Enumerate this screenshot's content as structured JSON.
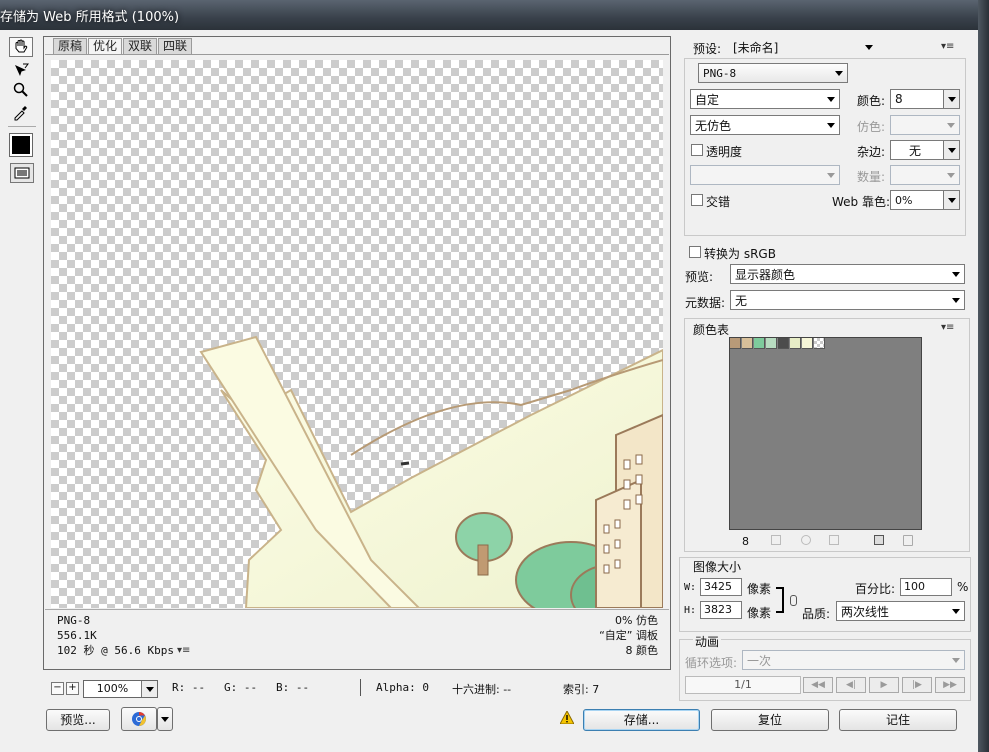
{
  "window": {
    "title": "存储为 Web 所用格式 (100%)"
  },
  "tools": [
    "hand-tool",
    "slice-select-tool",
    "zoom-tool",
    "eyedropper-tool"
  ],
  "tabs": [
    "原稿",
    "优化",
    "双联",
    "四联"
  ],
  "active_tab": "优化",
  "canvas_info": {
    "format": "PNG-8",
    "size": "556.1K",
    "speed": "102 秒 @ 56.6 Kbps",
    "dither": "0% 仿色",
    "palette": "“自定” 调板",
    "colors": "8 颜色"
  },
  "statusbar": {
    "zoom": "100%",
    "r": "R: --",
    "g": "G: --",
    "b": "B: --",
    "alpha": "Alpha: 0",
    "hex": "十六进制: --",
    "index": "索引: 7"
  },
  "buttons": {
    "preview": "预览...",
    "save": "存储...",
    "reset": "复位",
    "remember": "记住"
  },
  "settings": {
    "preset_label": "预设:",
    "preset_value": "[未命名]",
    "format": "PNG-8",
    "reduction": "自定",
    "colors_label": "颜色:",
    "colors_value": "8",
    "dither_algo": "无仿色",
    "dither_label": "仿色:",
    "transparency_label": "透明度",
    "matte_label": "杂边:",
    "matte_value": "无",
    "amount_label": "数量:",
    "interlaced_label": "交错",
    "websnap_label": "Web 靠色:",
    "websnap_value": "0%"
  },
  "color_mgmt": {
    "convert_label": "转换为 sRGB",
    "preview_label": "预览:",
    "preview_value": "显示器颜色",
    "metadata_label": "元数据:",
    "metadata_value": "无"
  },
  "color_table": {
    "title": "颜色表",
    "count": "8",
    "swatches": [
      "#b89a78",
      "#d8c09a",
      "#7ecb9c",
      "#b7dcc0",
      "#4c4c4c",
      "#e7edc6",
      "#f6f6d8",
      "transparent"
    ]
  },
  "image_size": {
    "title": "图像大小",
    "w_label": "W:",
    "w_value": "3425",
    "h_label": "H:",
    "h_value": "3823",
    "unit": "像素",
    "percent_label": "百分比:",
    "percent_value": "100",
    "percent_unit": "%",
    "quality_label": "品质:",
    "quality_value": "两次线性"
  },
  "animation": {
    "title": "动画",
    "loop_label": "循环选项:",
    "loop_value": "一次",
    "frame_counter": "1/1"
  }
}
